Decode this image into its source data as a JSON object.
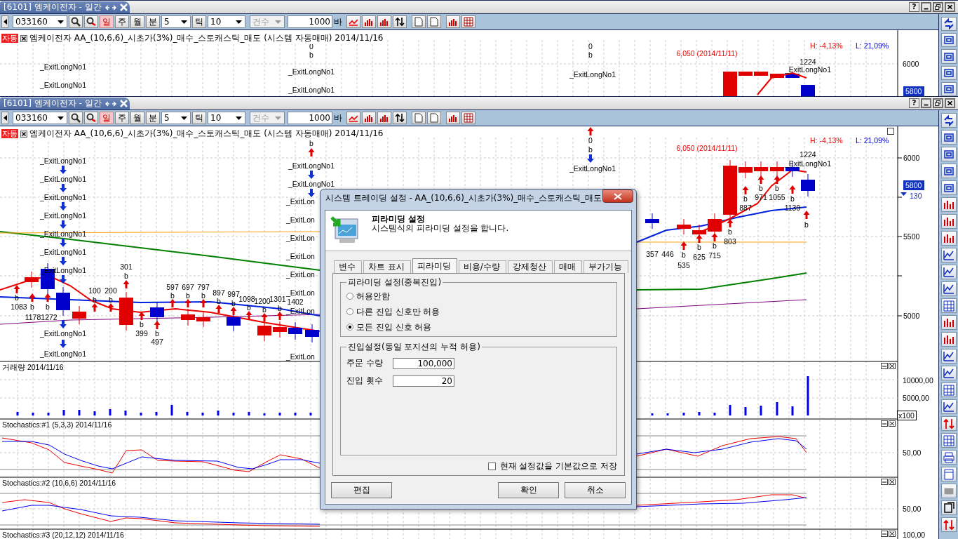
{
  "windows": [
    {
      "title": "[6101] 엠케이전자 - 일간",
      "help": "?",
      "toolbar": {
        "code": "033160",
        "periods": [
          {
            "label": "일",
            "selected": true
          },
          {
            "label": "주",
            "selected": false
          },
          {
            "label": "월",
            "selected": false
          },
          {
            "label": "분",
            "selected": false
          }
        ],
        "minute": "5",
        "tick_label": "틱",
        "tick": "10",
        "count_mode": "건수",
        "count": "1000",
        "count_unit": "바"
      },
      "chart": {
        "badge": "자동",
        "legend": "엠케이전자 AA_(10,6,6)_시초가(3%)_매수_스토캐스틱_매도 (시스템 자동매매) 2014/11/16",
        "high": "H: -4,13%",
        "low": "L: 21,09%",
        "labels": [
          "_ExitLongNo1",
          "_ExitLongNo1",
          "_ExitLongNo1",
          "_ExitLongNo1",
          "_ExitLongNo1",
          "_ExitLongNo1",
          "0",
          "b",
          "0",
          "b",
          "6,050 (2014/11/11)",
          "1224"
        ],
        "axis": [
          "6000"
        ],
        "current_price": "5800"
      }
    },
    {
      "title": "[6101] 엠케이전자 - 일간",
      "help": "?",
      "toolbar": {
        "code": "033160",
        "periods": [
          {
            "label": "일",
            "selected": true
          },
          {
            "label": "주",
            "selected": false
          },
          {
            "label": "월",
            "selected": false
          },
          {
            "label": "분",
            "selected": false
          }
        ],
        "minute": "5",
        "tick_label": "틱",
        "tick": "10",
        "count_mode": "건수",
        "count": "1000",
        "count_unit": "바"
      },
      "chart": {
        "badge": "자동",
        "legend": "엠케이전자 AA_(10,6,6)_시초가(3%)_매수_스토캐스틱_매도 (시스템 자동매매) 2014/11/16",
        "high": "H: -4,13%",
        "low": "L: 21,09%",
        "labels": [
          "_ExitLongNo1",
          "_ExitLongNo1",
          "_ExitLongNo1",
          "_ExitLongNo1",
          "_ExitLongNo1",
          "_ExitLongNo1",
          "_ExitLongNo1",
          "_ExitLongNo1",
          "_ExitLongNo1",
          "b",
          "_ExitLongNo1",
          "_ExitLongNo1",
          "_ExitLon",
          "_ExitLon",
          "_ExitLon",
          "_ExitLon",
          "_ExitLon",
          "_ExitLon",
          "_ExitLon",
          "_ExitLon",
          "0",
          "b",
          "_ExitLongNo1",
          "6,050 (2014/11/11)",
          "1224",
          "_ExitLongNo1",
          "b",
          "887",
          "b",
          "971",
          "b",
          "1055",
          "b",
          "1139",
          "b",
          "357",
          "446",
          "b",
          "535",
          "b",
          "625",
          "b",
          "715",
          "b",
          "803",
          "b",
          "1083",
          "b",
          "1178",
          "b",
          "1272",
          "100",
          "b",
          "200",
          "b",
          "301",
          "b",
          "b",
          "399",
          "b",
          "497",
          "597",
          "b",
          "697",
          "b",
          "797",
          "b",
          "897",
          "b",
          "997",
          "b",
          "1098",
          "b",
          "1200",
          "b",
          "1301",
          "b",
          "1402"
        ],
        "axis": [
          "6000",
          "5500",
          "5000"
        ],
        "current_price": "5800",
        "change": "130",
        "panels": [
          {
            "kind": "volume",
            "title": "거래량 2014/11/16",
            "axis": [
              "10000,00",
              "5000,00"
            ],
            "unit": "x100"
          },
          {
            "kind": "stochastic",
            "title": "Stochastics:#1  (5,3,3) 2014/11/16",
            "axis": [
              "50,00"
            ]
          },
          {
            "kind": "stochastic2",
            "title": "Stochastics:#2  (10,6,6) 2014/11/16",
            "axis": [
              "50,00"
            ]
          },
          {
            "kind": "stochastic3",
            "title": "Stochastics:#3  (20,12,12) 2014/11/16",
            "axis": [
              "100,00"
            ]
          }
        ]
      }
    }
  ],
  "dialog": {
    "title": "시스템 트레이딩 설정 - AA_(10,6,6)_시초가(3%)_매수_스토캐스틱_매도",
    "heading": "피라미딩 설정",
    "description": "시스템식의 피라미딩 설정을 합니다.",
    "tabs": [
      {
        "label": "변수",
        "selected": false
      },
      {
        "label": "차트 표시",
        "selected": false
      },
      {
        "label": "피라미딩",
        "selected": true
      },
      {
        "label": "비용/수량",
        "selected": false
      },
      {
        "label": "강제청산",
        "selected": false
      },
      {
        "label": "매매",
        "selected": false
      },
      {
        "label": "부가기능",
        "selected": false
      }
    ],
    "pyramid_group": {
      "title": "피라미딩 설정(중복진입)",
      "options": [
        {
          "label": "허용안함",
          "selected": false
        },
        {
          "label": "다른 진입 신호만 허용",
          "selected": false
        },
        {
          "label": "모든 진입 신호 허용",
          "selected": true
        }
      ]
    },
    "entry_group": {
      "title": "진입설정(동일 포지션의 누적 허용)",
      "fields": [
        {
          "label": "주문 수량",
          "value": "100,000"
        },
        {
          "label": "진입 횟수",
          "value": "20"
        }
      ]
    },
    "save_default": {
      "label": "현재 설정값을 기본값으로 저장",
      "checked": false
    },
    "buttons": {
      "edit": "편집",
      "ok": "확인",
      "cancel": "취소"
    }
  }
}
